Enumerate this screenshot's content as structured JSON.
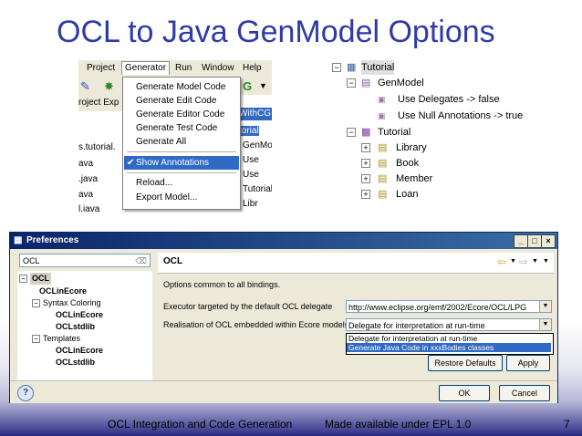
{
  "slide": {
    "title": "OCL to Java GenModel Options",
    "footer_left": "OCL Integration and Code Generation",
    "footer_center": "Made available under EPL 1.0",
    "page_number": "7"
  },
  "menu": {
    "menubar": [
      "Project",
      "Generator",
      "Run",
      "Window",
      "Help"
    ],
    "proj_tab": "roject Exp",
    "left_items": [
      "s.tutorial.",
      "ava",
      ".java",
      "ava",
      "l.iava"
    ],
    "dropdown": [
      "Generate Model Code",
      "Generate Edit Code",
      "Generate Editor Code",
      "Generate Test Code",
      "Generate All",
      "Show Annotations",
      "Reload...",
      "Export Model..."
    ],
    "right_items": [
      "torial",
      "GenMoc",
      "Use",
      "Use",
      "Tutorial",
      "Libr"
    ],
    "withcg": "WithCG"
  },
  "tree": {
    "root": "Tutorial",
    "genmodel": "GenModel",
    "use_delegates": "Use Delegates -> false",
    "use_null": "Use Null Annotations -> true",
    "package": "Tutorial",
    "classes": [
      "Library",
      "Book",
      "Member",
      "Loan"
    ]
  },
  "prefs": {
    "title": "Preferences",
    "filter_value": "OCL",
    "tree": {
      "ocl": "OCL",
      "ocl_in_ecore": "OCLinEcore",
      "syntax_coloring": "Syntax Coloring",
      "sc_oclinecore": "OCLinEcore",
      "sc_oclstdlib": "OCLstdlib",
      "templates": "Templates",
      "t_oclinecore": "OCLinEcore",
      "t_oclstdlib": "OCLstdlib"
    },
    "pane_title": "OCL",
    "description": "Options common to all bindings.",
    "executor_label": "Executor targeted by the default OCL delegate",
    "executor_value": "http://www.eclipse.org/emf/2002/Ecore/OCL/LPG",
    "realisation_label": "Realisation of OCL embedded within Ecore models",
    "realisation_value": "Delegate for interpretation at run-time",
    "realisation_options": [
      "Delegate for interpretation at run-time",
      "Generate Java Code in xxxBodies classes"
    ],
    "restore_defaults": "Restore Defaults",
    "apply": "Apply",
    "ok": "OK",
    "cancel": "Cancel",
    "help": "?"
  }
}
